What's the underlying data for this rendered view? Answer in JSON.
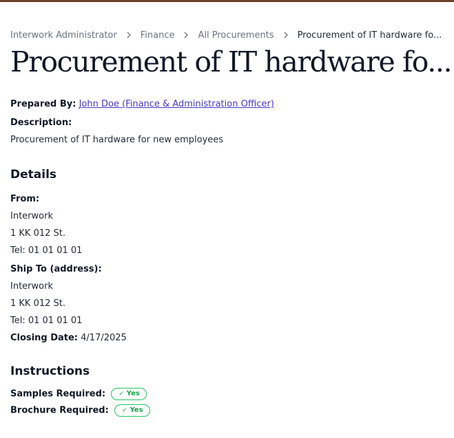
{
  "breadcrumb": {
    "items": [
      "Interwork Administrator",
      "Finance",
      "All Procurements"
    ],
    "current": "Procurement of IT hardware fo..."
  },
  "page": {
    "title": "Procurement of IT hardware fo..."
  },
  "summary": {
    "prepared_by_label": "Prepared By:",
    "prepared_by_value": "John Doe (Finance & Administration Officer)",
    "description_label": "Description:",
    "description_value": "Procurement of IT hardware for new employees"
  },
  "details": {
    "heading": "Details",
    "from_label": "From:",
    "from_lines": [
      "Interwork",
      "1 KK 012 St.",
      "Tel: 01 01 01 01"
    ],
    "ship_to_label": "Ship To (address):",
    "ship_to_lines": [
      "Interwork",
      "1 KK 012 St.",
      "Tel: 01 01 01 01"
    ],
    "closing_date_label": "Closing Date:",
    "closing_date_value": "4/17/2025"
  },
  "instructions": {
    "heading": "Instructions",
    "samples_label": "Samples Required:",
    "samples_value": "Yes",
    "brochure_label": "Brochure Required:",
    "brochure_value": "Yes"
  },
  "colors": {
    "accent_bar": "#6b3f2a",
    "link": "#4338ca",
    "badge_green": "#16a34a"
  },
  "icons": {
    "breadcrumb_separator": "chevron-right-icon",
    "badge_check": "check-icon"
  }
}
